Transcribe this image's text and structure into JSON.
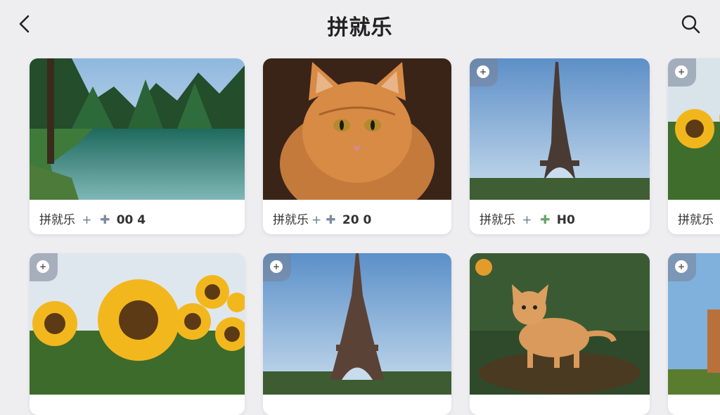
{
  "header": {
    "title": "拼就乐"
  },
  "icons": {
    "back": "chevron-left-icon",
    "search": "search-icon",
    "badge": "puzzle-piece-icon"
  },
  "row1": [
    {
      "scene": "forest lake",
      "label": "拼就乐",
      "plus": "+",
      "count": "00 4"
    },
    {
      "scene": "orange cat",
      "label": "拼就乐",
      "plus": "+",
      "count": "20 0"
    },
    {
      "scene": "eiffel tower",
      "label": "拼就乐",
      "plus": "+",
      "count": "H0"
    },
    {
      "scene": "sunflowers",
      "label": "拼就乐",
      "plus": "",
      "count": ""
    }
  ],
  "row2": [
    {
      "scene": "sunflowers"
    },
    {
      "scene": "eiffel tower"
    },
    {
      "scene": "kitten"
    },
    {
      "scene": "tower field"
    }
  ]
}
